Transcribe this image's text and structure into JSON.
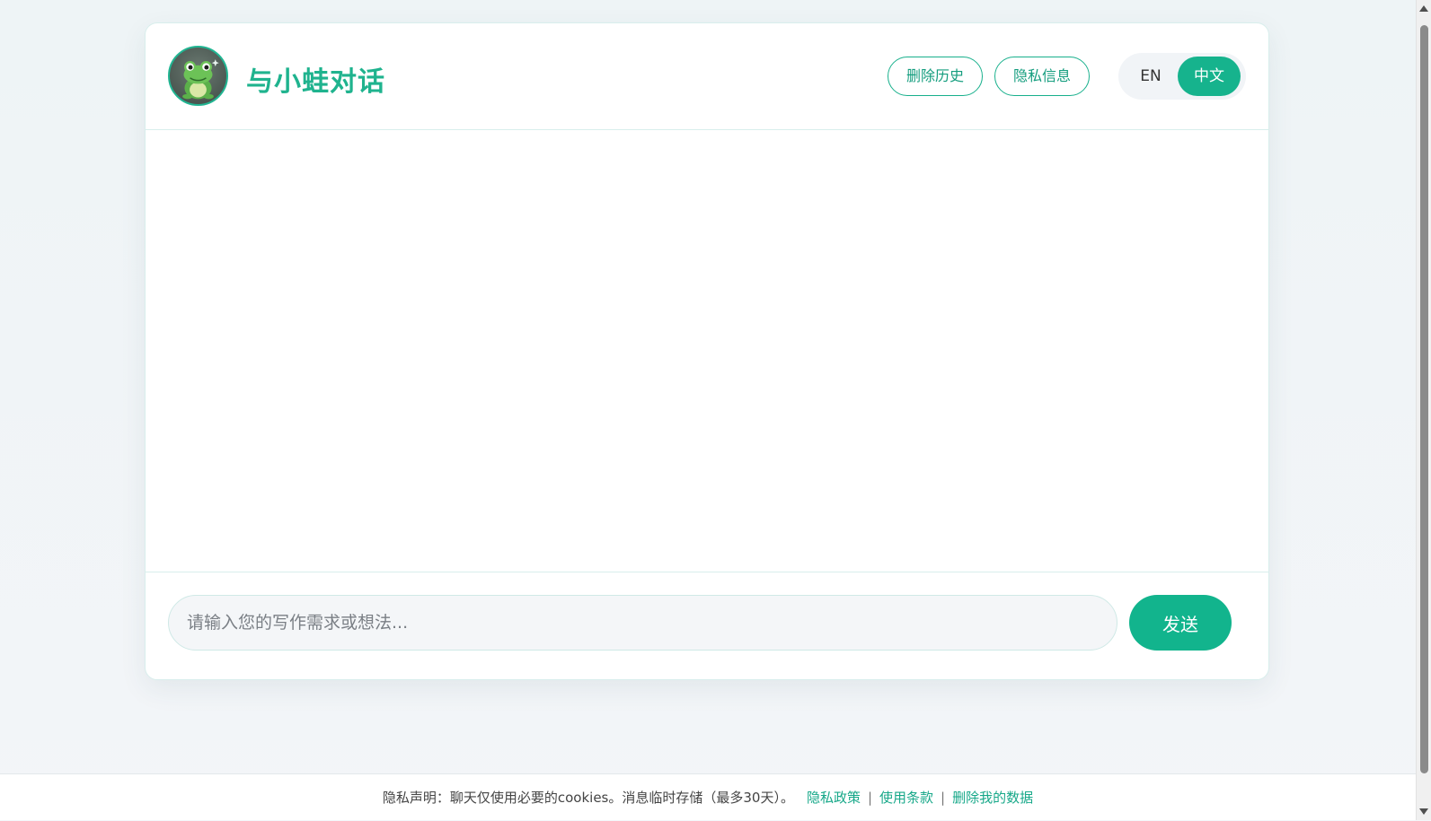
{
  "header": {
    "title": "与小蛙对话",
    "delete_history_label": "删除历史",
    "privacy_info_label": "隐私信息",
    "lang_en_label": "EN",
    "lang_zh_label": "中文",
    "active_language": "中文",
    "avatar_icon": "frog-avatar-icon"
  },
  "chat": {
    "messages": []
  },
  "input": {
    "placeholder": "请输入您的写作需求或想法...",
    "value": "",
    "send_label": "发送"
  },
  "footer": {
    "notice": "隐私声明：聊天仅使用必要的cookies。消息临时存储（最多30天）。",
    "privacy_policy_link": "隐私政策",
    "terms_link": "使用条款",
    "delete_data_link": "删除我的数据",
    "separator": "|"
  },
  "colors": {
    "accent": "#16b38d",
    "title": "#1fb38e",
    "link": "#17a889",
    "background": "#f3f6f9"
  }
}
